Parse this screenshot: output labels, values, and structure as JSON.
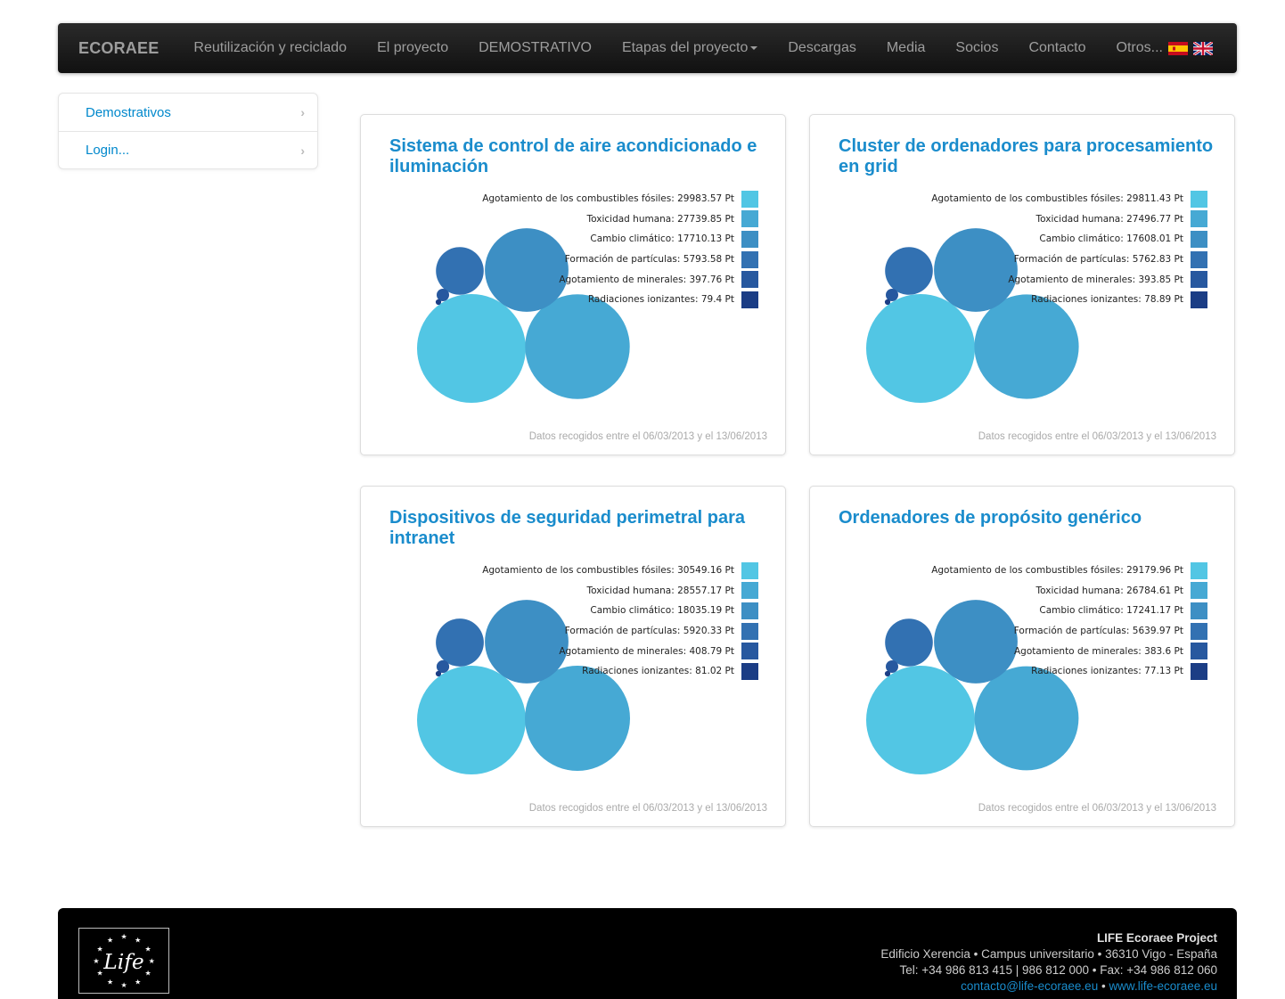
{
  "navbar": {
    "brand": "ECORAEE",
    "items": [
      {
        "label": "Reutilización y reciclado"
      },
      {
        "label": "El proyecto"
      },
      {
        "label": "DEMOSTRATIVO"
      },
      {
        "label": "Etapas del proyecto",
        "dropdown": true
      },
      {
        "label": "Descargas"
      },
      {
        "label": "Media"
      },
      {
        "label": "Socios"
      },
      {
        "label": "Contacto"
      },
      {
        "label": "Otros..."
      }
    ],
    "flags": [
      "spain-flag-icon",
      "uk-flag-icon"
    ]
  },
  "sidebar": {
    "items": [
      {
        "label": "Demostrativos"
      },
      {
        "label": "Login..."
      }
    ]
  },
  "colors": {
    "c1": "#52c6e4",
    "c2": "#46a9d4",
    "c3": "#3d8fc4",
    "c4": "#3271b2",
    "c5": "#27589f",
    "c6": "#1b3d85",
    "title": "#1a8ccc"
  },
  "cards": [
    {
      "title": "Sistema de control de aire acondicionado e iluminación",
      "note": "Datos recogidos entre el 06/03/2013 y el 13/06/2013",
      "metrics": [
        {
          "label": "Agotamiento de los combustibles fósiles: 29983.57 Pt",
          "value": 29983.57
        },
        {
          "label": "Toxicidad humana: 27739.85 Pt",
          "value": 27739.85
        },
        {
          "label": "Cambio climático: 17710.13 Pt",
          "value": 17710.13
        },
        {
          "label": "Formación de partículas: 5793.58 Pt",
          "value": 5793.58
        },
        {
          "label": "Agotamiento de minerales: 397.76 Pt",
          "value": 397.76
        },
        {
          "label": "Radiaciones ionizantes: 79.4 Pt",
          "value": 79.4
        }
      ]
    },
    {
      "title": "Cluster de ordenadores para procesamiento en grid",
      "note": "Datos recogidos entre el 06/03/2013 y el 13/06/2013",
      "metrics": [
        {
          "label": "Agotamiento de los combustibles fósiles: 29811.43 Pt",
          "value": 29811.43
        },
        {
          "label": "Toxicidad humana: 27496.77 Pt",
          "value": 27496.77
        },
        {
          "label": "Cambio climático: 17608.01 Pt",
          "value": 17608.01
        },
        {
          "label": "Formación de partículas: 5762.83 Pt",
          "value": 5762.83
        },
        {
          "label": "Agotamiento de minerales: 393.85 Pt",
          "value": 393.85
        },
        {
          "label": "Radiaciones ionizantes: 78.89 Pt",
          "value": 78.89
        }
      ]
    },
    {
      "title": "Dispositivos de seguridad perimetral para intranet",
      "note": "Datos recogidos entre el 06/03/2013 y el 13/06/2013",
      "metrics": [
        {
          "label": "Agotamiento de los combustibles fósiles: 30549.16 Pt",
          "value": 30549.16
        },
        {
          "label": "Toxicidad humana: 28557.17 Pt",
          "value": 28557.17
        },
        {
          "label": "Cambio climático: 18035.19 Pt",
          "value": 18035.19
        },
        {
          "label": "Formación de partículas: 5920.33 Pt",
          "value": 5920.33
        },
        {
          "label": "Agotamiento de minerales: 408.79 Pt",
          "value": 408.79
        },
        {
          "label": "Radiaciones ionizantes: 81.02 Pt",
          "value": 81.02
        }
      ]
    },
    {
      "title": "Ordenadores de propósito genérico",
      "note": "Datos recogidos entre el 06/03/2013 y el 13/06/2013",
      "metrics": [
        {
          "label": "Agotamiento de los combustibles fósiles: 29179.96 Pt",
          "value": 29179.96
        },
        {
          "label": "Toxicidad humana: 26784.61 Pt",
          "value": 26784.61
        },
        {
          "label": "Cambio climático: 17241.17 Pt",
          "value": 17241.17
        },
        {
          "label": "Formación de partículas: 5639.97 Pt",
          "value": 5639.97
        },
        {
          "label": "Agotamiento de minerales: 383.6 Pt",
          "value": 383.6
        },
        {
          "label": "Radiaciones ionizantes: 77.13 Pt",
          "value": 77.13
        }
      ]
    }
  ],
  "footer": {
    "logo_text": "Life",
    "project": "LIFE Ecoraee Project",
    "address": "Edificio Xerencia • Campus universitario • 36310 Vigo - España",
    "phones": "Tel: +34 986 813 415 | 986 812 000 • Fax: +34 986 812 060",
    "email": "contacto@life-ecoraee.eu",
    "separator": " • ",
    "website": "www.life-ecoraee.eu"
  }
}
